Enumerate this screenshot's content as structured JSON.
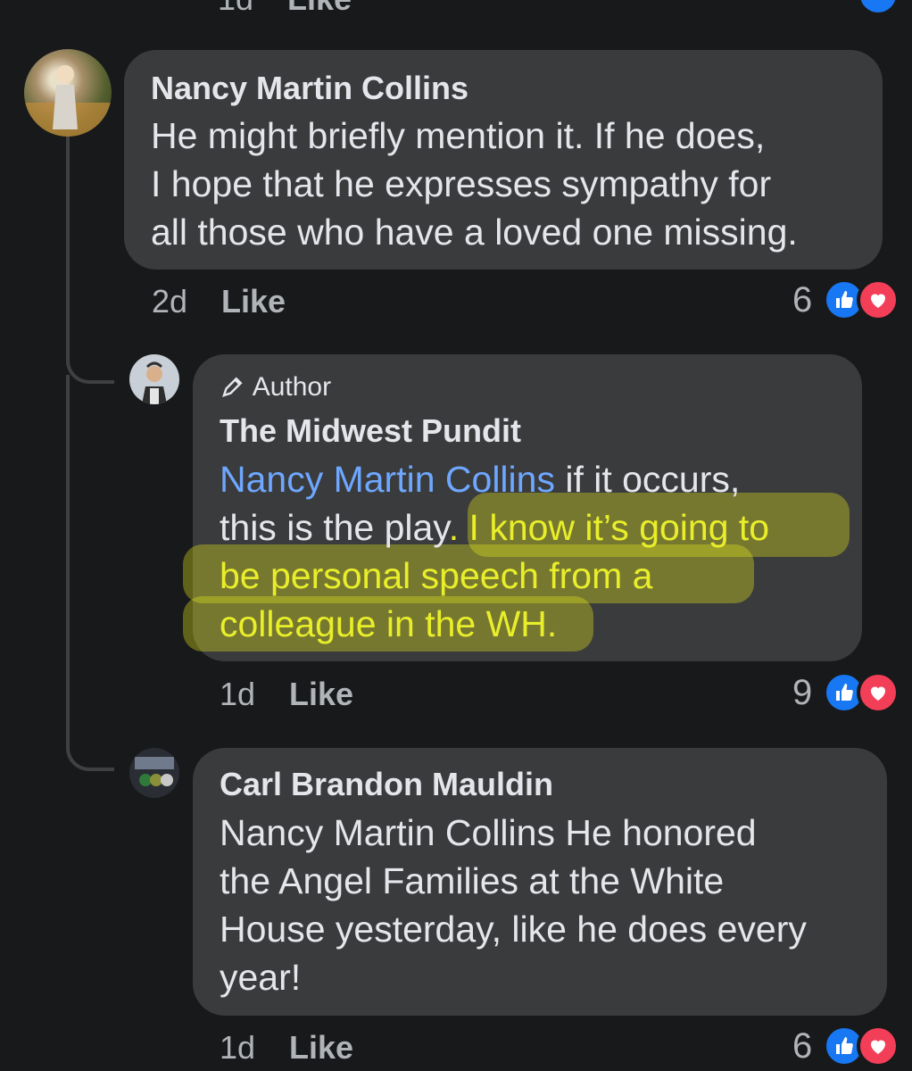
{
  "top_partial": {
    "time": "1d",
    "like_label": "Like"
  },
  "comments": [
    {
      "name": "Nancy Martin Collins",
      "lines": [
        "He might briefly mention it.  If he does,",
        "I hope that he expresses sympathy for",
        "all those who have a loved one missing."
      ],
      "time": "2d",
      "like_label": "Like",
      "reaction_count": "6"
    },
    {
      "badge": "Author",
      "name": "The Midwest Pundit",
      "mention": "Nancy Martin Collins",
      "line1_rest": " if it occurs,",
      "line2_plain": "this is the play",
      "line2_hl": ".  I know it’s going to",
      "line3_hl": "be personal speech from a",
      "line4_hl": "colleague in the WH.",
      "time": "1d",
      "like_label": "Like",
      "reaction_count": "9"
    },
    {
      "name": "Carl Brandon Mauldin",
      "lines": [
        "Nancy Martin Collins He honored",
        "the Angel Families at the White",
        "House yesterday, like he does every",
        "year!"
      ],
      "time": "1d",
      "like_label": "Like",
      "reaction_count": "6"
    }
  ],
  "icons": [
    "like-reaction-icon",
    "love-reaction-icon",
    "author-pen-icon"
  ],
  "colors": {
    "background": "#18191a",
    "bubble": "#3a3b3c",
    "mention": "#6ea7ff",
    "highlight": "#e9ee2a",
    "like": "#1877f2",
    "love": "#f33e58"
  }
}
